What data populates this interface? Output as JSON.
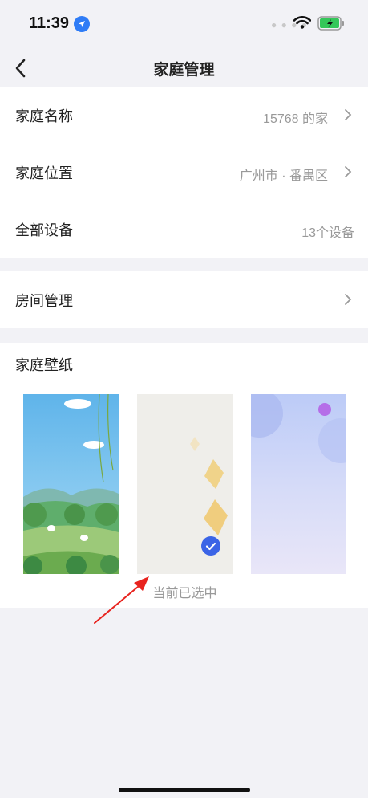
{
  "status": {
    "time": "11:39"
  },
  "nav": {
    "title": "家庭管理"
  },
  "family": {
    "name_label": "家庭名称",
    "name_value": "15768 的家",
    "location_label": "家庭位置",
    "location_value": "广州市 · 番禺区",
    "devices_label": "全部设备",
    "devices_value": "13个设备"
  },
  "rooms": {
    "label": "房间管理"
  },
  "wallpaper": {
    "title": "家庭壁纸",
    "selected_caption": "当前已选中",
    "options": [
      "landscape-rabbits",
      "beige-lanterns",
      "purple-gradient"
    ],
    "selected_index": 1
  },
  "colors": {
    "accent": "#3b64e6",
    "annotation_arrow": "#e8231e"
  }
}
